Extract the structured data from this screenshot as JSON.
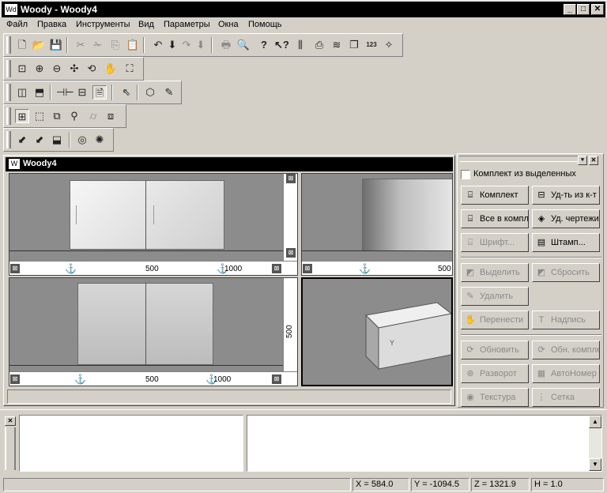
{
  "window": {
    "title": "Woody - Woody4",
    "app_icon": "Wd"
  },
  "menu": [
    "Файл",
    "Правка",
    "Инструменты",
    "Вид",
    "Параметры",
    "Окна",
    "Помощь"
  ],
  "toolbars": {
    "row1": [
      "new-file",
      "open-folder",
      "save",
      "cut",
      "scissors",
      "copy",
      "paste",
      "undo",
      "undo-list",
      "redo",
      "redo-list",
      "print",
      "print-preview",
      "help",
      "context-help",
      "columns",
      "export",
      "layers",
      "windows",
      "numbers",
      "wand"
    ],
    "row2": [
      "zoom-window",
      "zoom-in",
      "zoom-out",
      "pan",
      "rotate",
      "hand",
      "zoom-fit"
    ],
    "row3": [
      "cabinet-front",
      "cabinet-3d",
      "split-horizontal",
      "shelf",
      "drawing",
      "select-arrow",
      "box",
      "pencil"
    ],
    "row4": [
      "view-panel",
      "view-box",
      "view-wire",
      "view-point",
      "view-cylinder",
      "view-layers"
    ],
    "row5": [
      "move-a",
      "move-b",
      "move-c",
      "eye",
      "light"
    ]
  },
  "document": {
    "title": "Woody4",
    "rulers": {
      "tick1": "500",
      "tick2": "1000",
      "tick3": "500",
      "tick4": "1000",
      "vertical": "500",
      "right_top": "500"
    },
    "axis_label": "Y"
  },
  "panel": {
    "checkbox_label": "Комплект из выделенных",
    "buttons": [
      {
        "label": "Комплект",
        "icon": "set-icon",
        "glyph": "⌸"
      },
      {
        "label": "Уд-ть из к-т",
        "icon": "remove-from-set-icon",
        "glyph": "⊟"
      },
      {
        "label": "Все в компл",
        "icon": "all-to-set-icon",
        "glyph": "⌸"
      },
      {
        "label": "Уд. чертежи",
        "icon": "delete-drawings-icon",
        "glyph": "◈"
      },
      {
        "label": "Шрифт...",
        "icon": "font-icon",
        "glyph": "⌸"
      },
      {
        "label": "Штамп...",
        "icon": "stamp-icon",
        "glyph": "▤"
      },
      {
        "label": "Выделить",
        "icon": "select-icon",
        "glyph": "◩"
      },
      {
        "label": "Сбросить",
        "icon": "reset-icon",
        "glyph": "◩"
      },
      {
        "label": "Удалить",
        "icon": "delete-icon",
        "glyph": "✎"
      },
      {
        "label": "Перенести",
        "icon": "move-icon",
        "glyph": "✋"
      },
      {
        "label": "Надпись",
        "icon": "text-label-icon",
        "glyph": "T"
      },
      {
        "label": "Обновить",
        "icon": "refresh-icon",
        "glyph": "⟳"
      },
      {
        "label": "Обн. компле",
        "icon": "refresh-set-icon",
        "glyph": "⟳"
      },
      {
        "label": "Разворот",
        "icon": "unfold-icon",
        "glyph": "⊛"
      },
      {
        "label": "АвтоНомер",
        "icon": "auto-number-icon",
        "glyph": "▦"
      },
      {
        "label": "Текстура",
        "icon": "texture-icon",
        "glyph": "◉"
      },
      {
        "label": "Сетка",
        "icon": "grid-icon",
        "glyph": "⋮"
      }
    ]
  },
  "status": {
    "x": "X = 584.0",
    "y": "Y = -1094.5",
    "z": "Z = 1321.9",
    "h": "H = 1.0"
  }
}
